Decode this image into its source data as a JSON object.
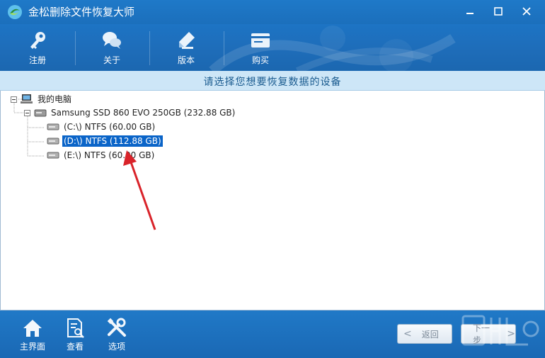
{
  "app": {
    "title": "金松删除文件恢复大师",
    "accent": "#1b6fbc"
  },
  "window_controls": [
    {
      "name": "minimize-icon"
    },
    {
      "name": "maximize-icon"
    },
    {
      "name": "close-icon"
    }
  ],
  "toolbar": {
    "register": {
      "label": "注册",
      "icon": "key-icon"
    },
    "about": {
      "label": "关于",
      "icon": "chat-bubbles-icon"
    },
    "version": {
      "label": "版本",
      "icon": "pencil-tag-icon"
    },
    "buy": {
      "label": "购买",
      "icon": "card-icon"
    }
  },
  "banner": {
    "text": "请选择您想要恢复数据的设备"
  },
  "tree": {
    "root": {
      "label": "我的电脑",
      "icon": "computer-icon"
    },
    "disk": {
      "label": "Samsung SSD 860 EVO 250GB (232.88 GB)",
      "icon": "hard-disk-icon"
    },
    "partitions": [
      {
        "label": "(C:\\) NTFS (60.00 GB)",
        "selected": false
      },
      {
        "label": "(D:\\) NTFS (112.88 GB)",
        "selected": true
      },
      {
        "label": "(E:\\) NTFS (60.00 GB)",
        "selected": false
      }
    ],
    "selection_color": "#0a64c8"
  },
  "annotation": {
    "arrow_color": "#d9232a"
  },
  "footer": {
    "home": {
      "label": "主界面",
      "icon": "home-icon"
    },
    "view": {
      "label": "查看",
      "icon": "document-search-icon"
    },
    "options": {
      "label": "选项",
      "icon": "tools-icon"
    },
    "back": {
      "label": "返回",
      "arrow": "<"
    },
    "next": {
      "label": "下一步",
      "arrow": ">"
    }
  }
}
